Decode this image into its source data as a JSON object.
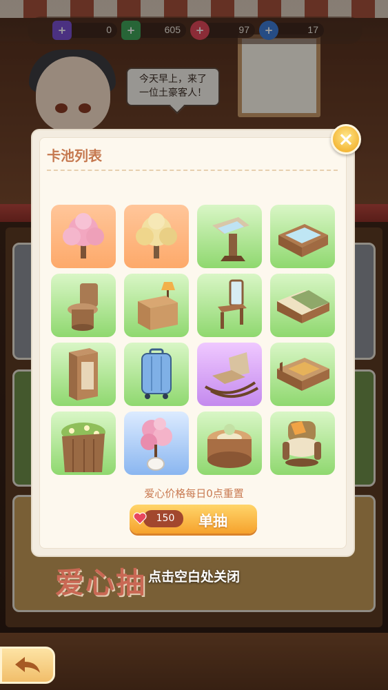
{
  "currencies": [
    {
      "name": "ticket",
      "icon": "ticket-icon",
      "value": "0",
      "color": "#7a4fd0"
    },
    {
      "name": "cash",
      "icon": "cash-icon",
      "value": "605",
      "color": "#3fa35a"
    },
    {
      "name": "heart",
      "icon": "heart-icon",
      "value": "97",
      "color": "#e0475a"
    },
    {
      "name": "diamond",
      "icon": "diamond-icon",
      "value": "17",
      "color": "#3e7bd6"
    }
  ],
  "dialog": {
    "text_line1": "今天早上，来了",
    "text_line2": "一位土豪客人！"
  },
  "modal": {
    "title": "卡池列表",
    "items": [
      {
        "name": "pink-cherry-tree",
        "rarity": "orange"
      },
      {
        "name": "golden-tree",
        "rarity": "orange"
      },
      {
        "name": "sink-stand",
        "rarity": "green"
      },
      {
        "name": "wooden-bathtub",
        "rarity": "green"
      },
      {
        "name": "toilet",
        "rarity": "green"
      },
      {
        "name": "nightstand-lamp",
        "rarity": "green"
      },
      {
        "name": "vanity-mirror",
        "rarity": "green"
      },
      {
        "name": "bed",
        "rarity": "green"
      },
      {
        "name": "wardrobe",
        "rarity": "green"
      },
      {
        "name": "suitcase",
        "rarity": "green"
      },
      {
        "name": "rocking-chair",
        "rarity": "purple"
      },
      {
        "name": "wooden-bench-bed",
        "rarity": "green"
      },
      {
        "name": "flower-planter",
        "rarity": "green"
      },
      {
        "name": "cherry-bonsai",
        "rarity": "blue"
      },
      {
        "name": "round-table",
        "rarity": "green"
      },
      {
        "name": "armchair",
        "rarity": "green"
      }
    ],
    "reset_note": "爱心价格每日0点重置",
    "draw_cost": "150",
    "draw_label": "单抽"
  },
  "hint": "点击空白处关闭",
  "banner": "爱心抽"
}
